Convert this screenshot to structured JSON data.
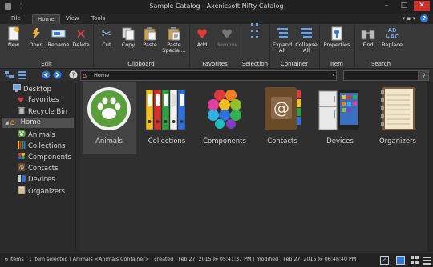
{
  "window": {
    "title": "Sample Catalog - Axenicsoft Nifty Catalog"
  },
  "tabs": [
    {
      "label": "File",
      "active": false
    },
    {
      "label": "Home",
      "active": true
    },
    {
      "label": "View",
      "active": false
    },
    {
      "label": "Tools",
      "active": false
    }
  ],
  "ribbon": {
    "groups": [
      {
        "name": "Edit",
        "buttons": [
          "New",
          "Open",
          "Rename",
          "Delete"
        ]
      },
      {
        "name": "Clipboard",
        "buttons": [
          "Cut",
          "Copy",
          "Paste",
          "Paste Special..."
        ]
      },
      {
        "name": "Favorites",
        "buttons": [
          "Add",
          "Remove"
        ]
      },
      {
        "name": "Selection",
        "buttons": []
      },
      {
        "name": "Container",
        "buttons": [
          "Expand All",
          "Collapse All"
        ]
      },
      {
        "name": "Item",
        "buttons": [
          "Properties"
        ]
      },
      {
        "name": "Search",
        "buttons": [
          "Find",
          "Replace"
        ]
      }
    ]
  },
  "address": {
    "path": "Home"
  },
  "sidebar": {
    "items": [
      {
        "label": "Desktop",
        "icon": "desktop-icon"
      },
      {
        "label": "Favorites",
        "icon": "heart-icon"
      },
      {
        "label": "Recycle Bin",
        "icon": "recycle-bin-icon"
      },
      {
        "label": "Home",
        "icon": "home-icon",
        "selected": true
      },
      {
        "label": "Animals",
        "icon": "paw-icon"
      },
      {
        "label": "Collections",
        "icon": "binders-icon"
      },
      {
        "label": "Components",
        "icon": "hexagons-icon"
      },
      {
        "label": "Contacts",
        "icon": "address-book-icon"
      },
      {
        "label": "Devices",
        "icon": "devices-icon"
      },
      {
        "label": "Organizers",
        "icon": "organizer-icon"
      }
    ]
  },
  "items": [
    {
      "label": "Animals",
      "icon": "paw-icon",
      "selected": true
    },
    {
      "label": "Collections",
      "icon": "binders-icon"
    },
    {
      "label": "Components",
      "icon": "hexagons-icon"
    },
    {
      "label": "Contacts",
      "icon": "address-book-icon"
    },
    {
      "label": "Devices",
      "icon": "devices-icon"
    },
    {
      "label": "Organizers",
      "icon": "organizer-icon"
    }
  ],
  "status": {
    "text": "6 Items  |  1 item selected  |  Animals <Animals Container>  |  created : Feb 27, 2015 @ 05:41:37 PM  |  modified : Feb 27, 2015 @ 06:48:40 PM"
  },
  "colors": {
    "accent": "#2f7ad8",
    "close": "#c9302c",
    "selection": "#505050"
  }
}
